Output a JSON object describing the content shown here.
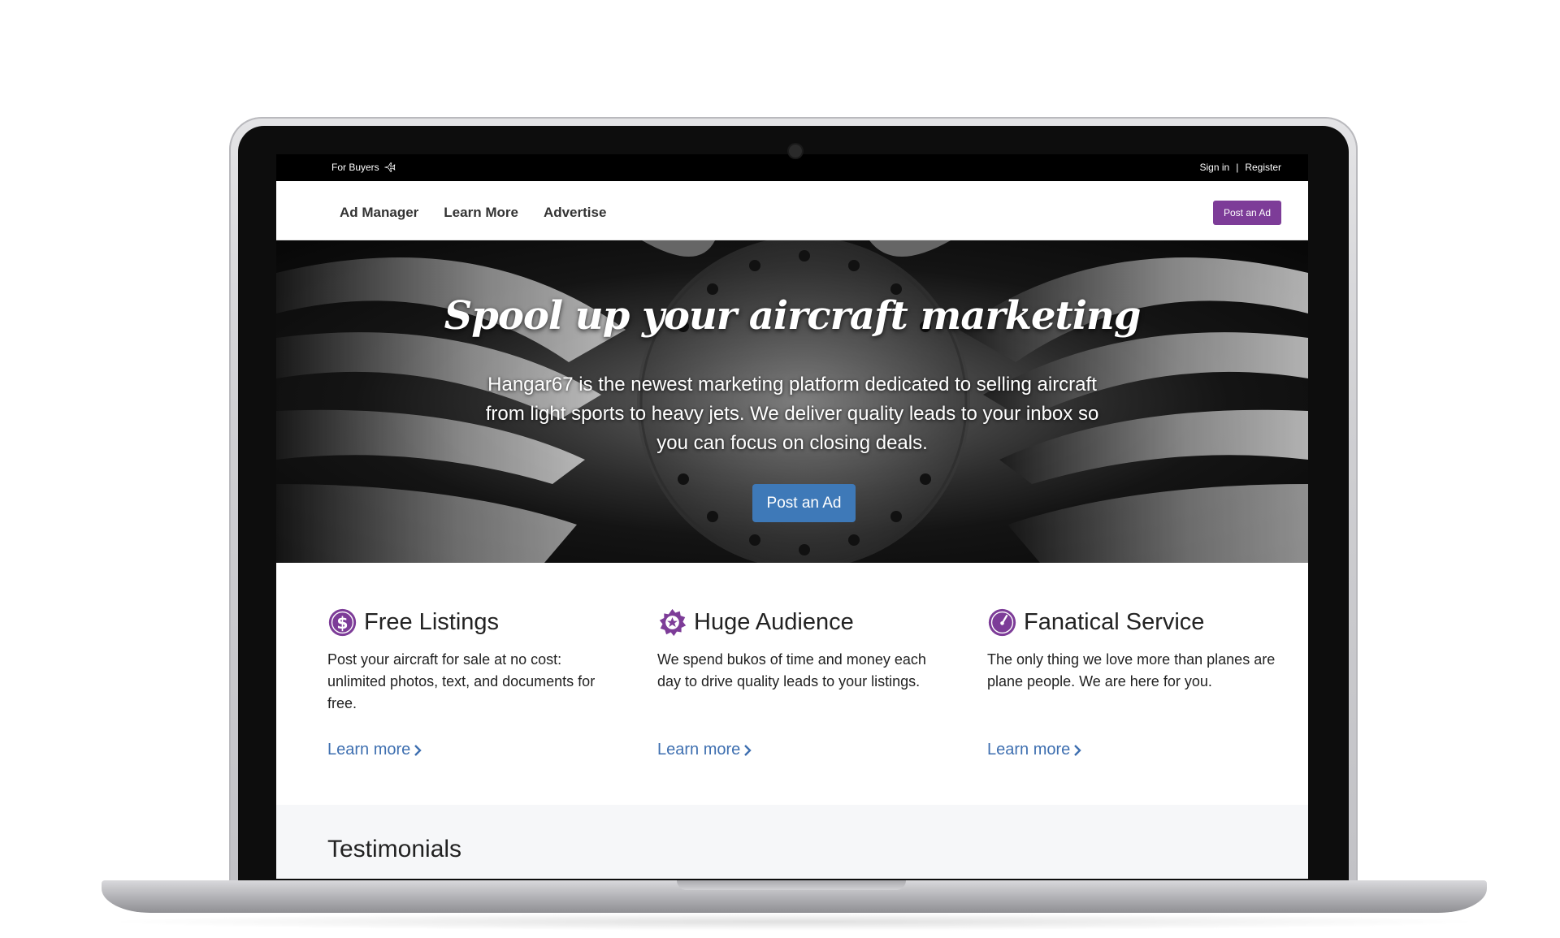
{
  "topbar": {
    "for_buyers": "For Buyers",
    "sign_in": "Sign in",
    "separator": "|",
    "register": "Register"
  },
  "nav": {
    "links": [
      "Ad Manager",
      "Learn More",
      "Advertise"
    ],
    "post_ad": "Post an Ad"
  },
  "hero": {
    "title": "Spool up your aircraft marketing",
    "description": "Hangar67 is the newest marketing platform dedicated to selling aircraft from light sports to heavy jets. We deliver quality leads to your inbox so you can focus on closing deals.",
    "cta": "Post an Ad"
  },
  "features": [
    {
      "icon": "dollar-icon",
      "title": "Free Listings",
      "description": "Post your aircraft for sale at no cost: unlimited photos, text, and documents for free.",
      "link": "Learn more"
    },
    {
      "icon": "badge-star-icon",
      "title": "Huge Audience",
      "description": "We spend bukos of time and money each day to drive quality leads to your listings.",
      "link": "Learn more"
    },
    {
      "icon": "gauge-icon",
      "title": "Fanatical Service",
      "description": "The only thing we love more than planes are plane people. We are here for you.",
      "link": "Learn more"
    }
  ],
  "testimonials": {
    "title": "Testimonials"
  },
  "colors": {
    "brand_purple": "#7d3c98",
    "hero_button_blue": "#3e79b8",
    "link_blue": "#3e6fb0"
  }
}
